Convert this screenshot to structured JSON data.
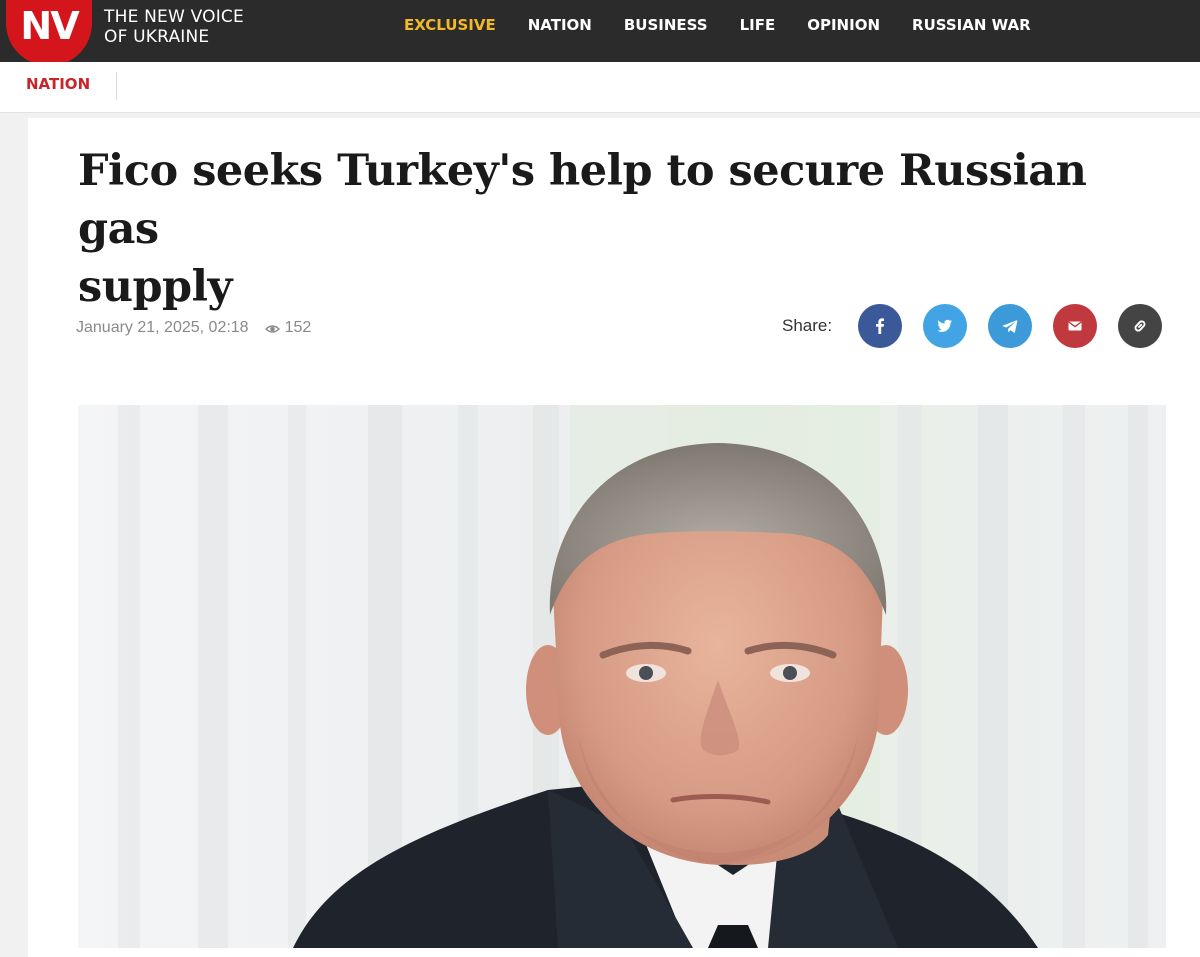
{
  "header": {
    "logo_text": "NV",
    "tagline_line1": "THE NEW VOICE",
    "tagline_line2": "OF UKRAINE",
    "nav": [
      {
        "label": "EXCLUSIVE",
        "active": true
      },
      {
        "label": "NATION",
        "active": false
      },
      {
        "label": "BUSINESS",
        "active": false
      },
      {
        "label": "LIFE",
        "active": false
      },
      {
        "label": "OPINION",
        "active": false
      },
      {
        "label": "RUSSIAN WAR",
        "active": false
      }
    ],
    "colors": {
      "bar": "#2b2b2b",
      "logo": "#d4161c",
      "active": "#f2b928"
    }
  },
  "section": {
    "label": "NATION",
    "color": "#c8242a"
  },
  "article": {
    "title_line1": "Fico seeks Turkey's help to secure Russian gas",
    "title_line2": "supply",
    "date": "January 21, 2025, 02:18",
    "views": "152",
    "views_icon": "eye-icon"
  },
  "share": {
    "label": "Share:",
    "buttons": [
      {
        "name": "facebook",
        "icon": "facebook-icon",
        "color": "#3b5998"
      },
      {
        "name": "twitter",
        "icon": "twitter-icon",
        "color": "#42a4e5"
      },
      {
        "name": "telegram",
        "icon": "telegram-icon",
        "color": "#3d9ad8"
      },
      {
        "name": "email",
        "icon": "email-icon",
        "color": "#c0393f"
      },
      {
        "name": "copy-link",
        "icon": "link-icon",
        "color": "#444444"
      }
    ]
  },
  "photo": {
    "subject": "portrait of a man in a dark suit against a white curtain"
  }
}
